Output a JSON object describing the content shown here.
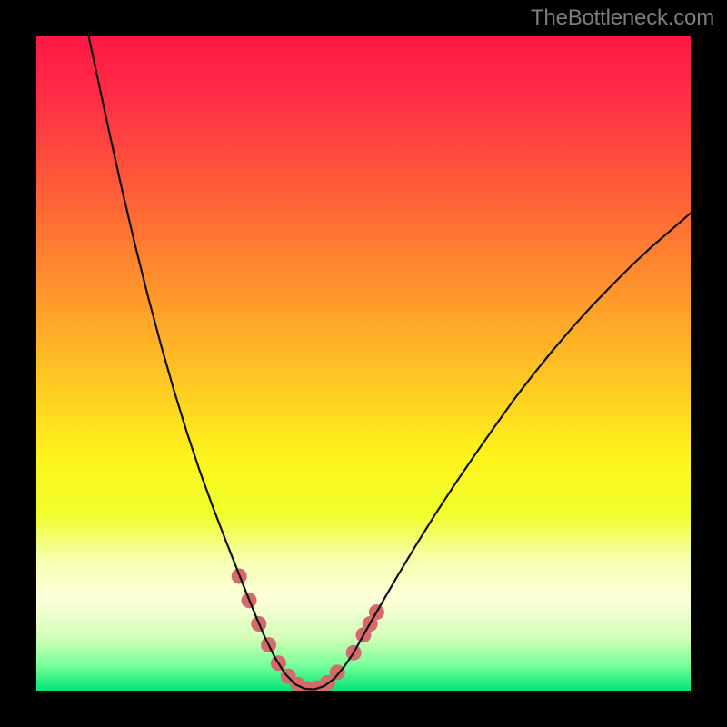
{
  "watermark": "TheBottleneck.com",
  "chart_data": {
    "type": "line",
    "title": "",
    "xlabel": "",
    "ylabel": "",
    "xlim": [
      0,
      100
    ],
    "ylim": [
      0,
      100
    ],
    "gradient_stops": [
      {
        "offset": 0.0,
        "color": "#ff1744"
      },
      {
        "offset": 0.09,
        "color": "#ff2d47"
      },
      {
        "offset": 0.18,
        "color": "#ff4a3d"
      },
      {
        "offset": 0.27,
        "color": "#ff6a35"
      },
      {
        "offset": 0.36,
        "color": "#ff8a2f"
      },
      {
        "offset": 0.45,
        "color": "#ffab28"
      },
      {
        "offset": 0.55,
        "color": "#ffd022"
      },
      {
        "offset": 0.64,
        "color": "#fff31c"
      },
      {
        "offset": 0.73,
        "color": "#f0ff2b"
      },
      {
        "offset": 0.8,
        "color": "#f7ffb0"
      },
      {
        "offset": 0.86,
        "color": "#fdffda"
      },
      {
        "offset": 0.92,
        "color": "#d2ffb8"
      },
      {
        "offset": 0.96,
        "color": "#7cff9c"
      },
      {
        "offset": 1.0,
        "color": "#00e676"
      }
    ],
    "series": [
      {
        "name": "curve",
        "color": "#111111",
        "stroke_width": 2.2,
        "points": [
          {
            "x": 8.0,
            "y": 100.0
          },
          {
            "x": 9.5,
            "y": 93.0
          },
          {
            "x": 11.0,
            "y": 86.0
          },
          {
            "x": 13.0,
            "y": 77.0
          },
          {
            "x": 15.0,
            "y": 68.5
          },
          {
            "x": 17.0,
            "y": 60.5
          },
          {
            "x": 19.0,
            "y": 53.0
          },
          {
            "x": 21.0,
            "y": 46.0
          },
          {
            "x": 23.0,
            "y": 39.5
          },
          {
            "x": 25.0,
            "y": 33.5
          },
          {
            "x": 27.0,
            "y": 28.0
          },
          {
            "x": 29.0,
            "y": 22.8
          },
          {
            "x": 30.5,
            "y": 19.0
          },
          {
            "x": 32.0,
            "y": 15.2
          },
          {
            "x": 33.5,
            "y": 11.5
          },
          {
            "x": 35.0,
            "y": 8.0
          },
          {
            "x": 36.5,
            "y": 5.0
          },
          {
            "x": 38.0,
            "y": 2.6
          },
          {
            "x": 39.5,
            "y": 1.0
          },
          {
            "x": 41.0,
            "y": 0.3
          },
          {
            "x": 42.5,
            "y": 0.2
          },
          {
            "x": 44.0,
            "y": 0.7
          },
          {
            "x": 45.5,
            "y": 1.8
          },
          {
            "x": 47.0,
            "y": 3.6
          },
          {
            "x": 48.5,
            "y": 5.8
          },
          {
            "x": 50.0,
            "y": 8.5
          },
          {
            "x": 52.0,
            "y": 12.0
          },
          {
            "x": 55.0,
            "y": 17.2
          },
          {
            "x": 58.0,
            "y": 22.2
          },
          {
            "x": 61.0,
            "y": 27.0
          },
          {
            "x": 64.0,
            "y": 31.6
          },
          {
            "x": 67.0,
            "y": 36.0
          },
          {
            "x": 70.0,
            "y": 40.3
          },
          {
            "x": 73.0,
            "y": 44.5
          },
          {
            "x": 76.0,
            "y": 48.4
          },
          {
            "x": 79.0,
            "y": 52.1
          },
          {
            "x": 82.0,
            "y": 55.6
          },
          {
            "x": 85.0,
            "y": 58.9
          },
          {
            "x": 88.0,
            "y": 62.0
          },
          {
            "x": 91.0,
            "y": 65.0
          },
          {
            "x": 94.0,
            "y": 67.8
          },
          {
            "x": 97.0,
            "y": 70.4
          },
          {
            "x": 100.0,
            "y": 73.0
          }
        ]
      },
      {
        "name": "markers",
        "color": "#d46a6a",
        "radius": 8.5,
        "points": [
          {
            "x": 31.0,
            "y": 17.5
          },
          {
            "x": 32.5,
            "y": 13.8
          },
          {
            "x": 34.0,
            "y": 10.2
          },
          {
            "x": 35.5,
            "y": 7.0
          },
          {
            "x": 37.0,
            "y": 4.2
          },
          {
            "x": 38.5,
            "y": 2.2
          },
          {
            "x": 40.0,
            "y": 0.9
          },
          {
            "x": 41.5,
            "y": 0.3
          },
          {
            "x": 43.0,
            "y": 0.4
          },
          {
            "x": 44.5,
            "y": 1.2
          },
          {
            "x": 46.0,
            "y": 2.8
          },
          {
            "x": 48.5,
            "y": 5.8
          },
          {
            "x": 50.0,
            "y": 8.5
          },
          {
            "x": 51.0,
            "y": 10.2
          },
          {
            "x": 52.0,
            "y": 12.0
          }
        ]
      }
    ]
  }
}
